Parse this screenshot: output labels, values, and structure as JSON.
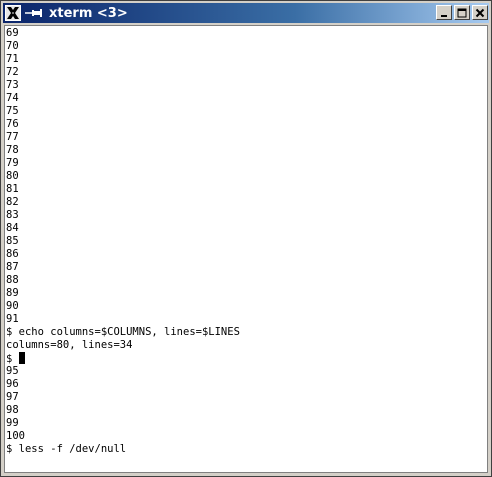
{
  "window": {
    "title": "xterm <3>",
    "app_icon": "x-logo-icon",
    "pin_icon": "pushpin-icon",
    "buttons": [
      "minimize-icon",
      "maximize-icon",
      "close-icon"
    ]
  },
  "terminal": {
    "lines": [
      "69",
      "70",
      "71",
      "72",
      "73",
      "74",
      "75",
      "76",
      "77",
      "78",
      "79",
      "80",
      "81",
      "82",
      "83",
      "84",
      "85",
      "86",
      "87",
      "88",
      "89",
      "90",
      "91",
      "$ echo columns=$COLUMNS, lines=$LINES",
      "columns=80, lines=34",
      "$ ",
      "95",
      "96",
      "97",
      "98",
      "99",
      "100",
      "$ less -f /dev/null"
    ],
    "cursor_line_index": 25
  },
  "colors": {
    "titlebar_start": "#0a246a",
    "titlebar_end": "#a6caf0",
    "terminal_bg": "#ffffff",
    "terminal_fg": "#000000"
  }
}
